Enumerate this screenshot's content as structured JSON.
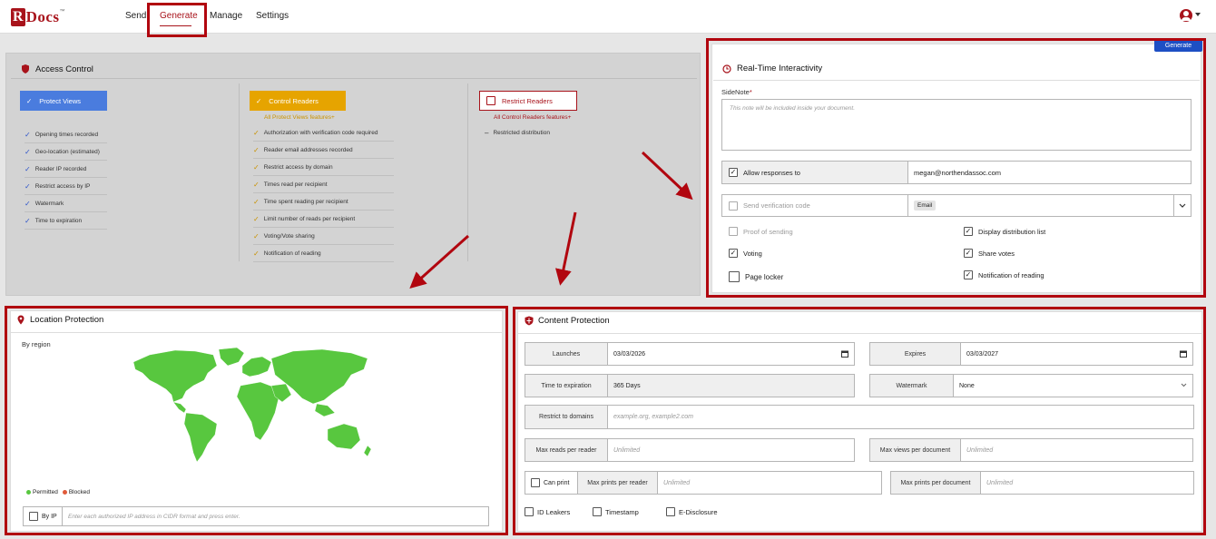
{
  "nav": {
    "logo_r": "R",
    "logo_docs": "Docs",
    "logo_tm": "™",
    "items": [
      "Send",
      "Generate",
      "Manage",
      "Settings"
    ]
  },
  "generate_button": "Generate",
  "access_control": {
    "title": "Access Control",
    "protect_views": {
      "label": "Protect Views",
      "items": [
        "Opening times recorded",
        "Geo-location (estimated)",
        "Reader IP recorded",
        "Restrict access by IP",
        "Watermark",
        "Time to expiration"
      ]
    },
    "control_readers": {
      "label": "Control Readers",
      "note": "All Protect Views features+",
      "items": [
        "Authorization with verification code required",
        "Reader email addresses recorded",
        "Restrict access by domain",
        "Times read per recipient",
        "Time spent reading per recipient",
        "Limit number of reads per recipient",
        "Voting/Vote sharing",
        "Notification of reading"
      ]
    },
    "restrict_readers": {
      "label": "Restrict Readers",
      "note": "All Control Readers features+",
      "items": [
        "Restricted distribution"
      ]
    }
  },
  "rti": {
    "title": "Real-Time Interactivity",
    "sidenote_label": "SideNote",
    "sidenote_required": "*",
    "sidenote_placeholder": "This note will be included inside your document.",
    "allow_responses_label": "Allow responses to",
    "allow_responses_value": "megan@northendassoc.com",
    "send_verification_label": "Send verification code",
    "verification_method": "Email",
    "options": {
      "proof_of_sending": "Proof of sending",
      "display_distribution": "Display distribution list",
      "voting": "Voting",
      "share_votes": "Share votes",
      "page_locker": "Page locker",
      "notification_reading": "Notification of reading"
    }
  },
  "location": {
    "title": "Location Protection",
    "by_region": "By region",
    "permitted": "Permitted",
    "blocked": "Blocked",
    "by_ip_label": "By IP",
    "by_ip_placeholder": "Enter each authorized IP address in CIDR format and press enter."
  },
  "content": {
    "title": "Content Protection",
    "launches_label": "Launches",
    "launches_value": "03/03/2026",
    "expires_label": "Expires",
    "expires_value": "03/03/2027",
    "time_exp_label": "Time to expiration",
    "time_exp_value": "365 Days",
    "watermark_label": "Watermark",
    "watermark_value": "None",
    "domains_label": "Restrict to domains",
    "domains_placeholder": "example.org, example2.com",
    "max_reads_label": "Max reads per reader",
    "max_reads_value": "Unlimited",
    "max_views_label": "Max views per document",
    "max_views_value": "Unlimited",
    "can_print_label": "Can print",
    "max_prints_reader_label": "Max prints per reader",
    "max_prints_reader_value": "Unlimited",
    "max_prints_doc_label": "Max prints per document",
    "max_prints_doc_value": "Unlimited",
    "id_leakers": "ID Leakers",
    "timestamp": "Timestamp",
    "e_disclosure": "E-Disclosure"
  },
  "colors": {
    "brand": "#a8131b",
    "protect_views": "#4a7cde",
    "control_readers": "#e6a400",
    "map_green": "#58c73f",
    "highlight": "#b1060f",
    "generate_btn": "#1d4fc4"
  }
}
